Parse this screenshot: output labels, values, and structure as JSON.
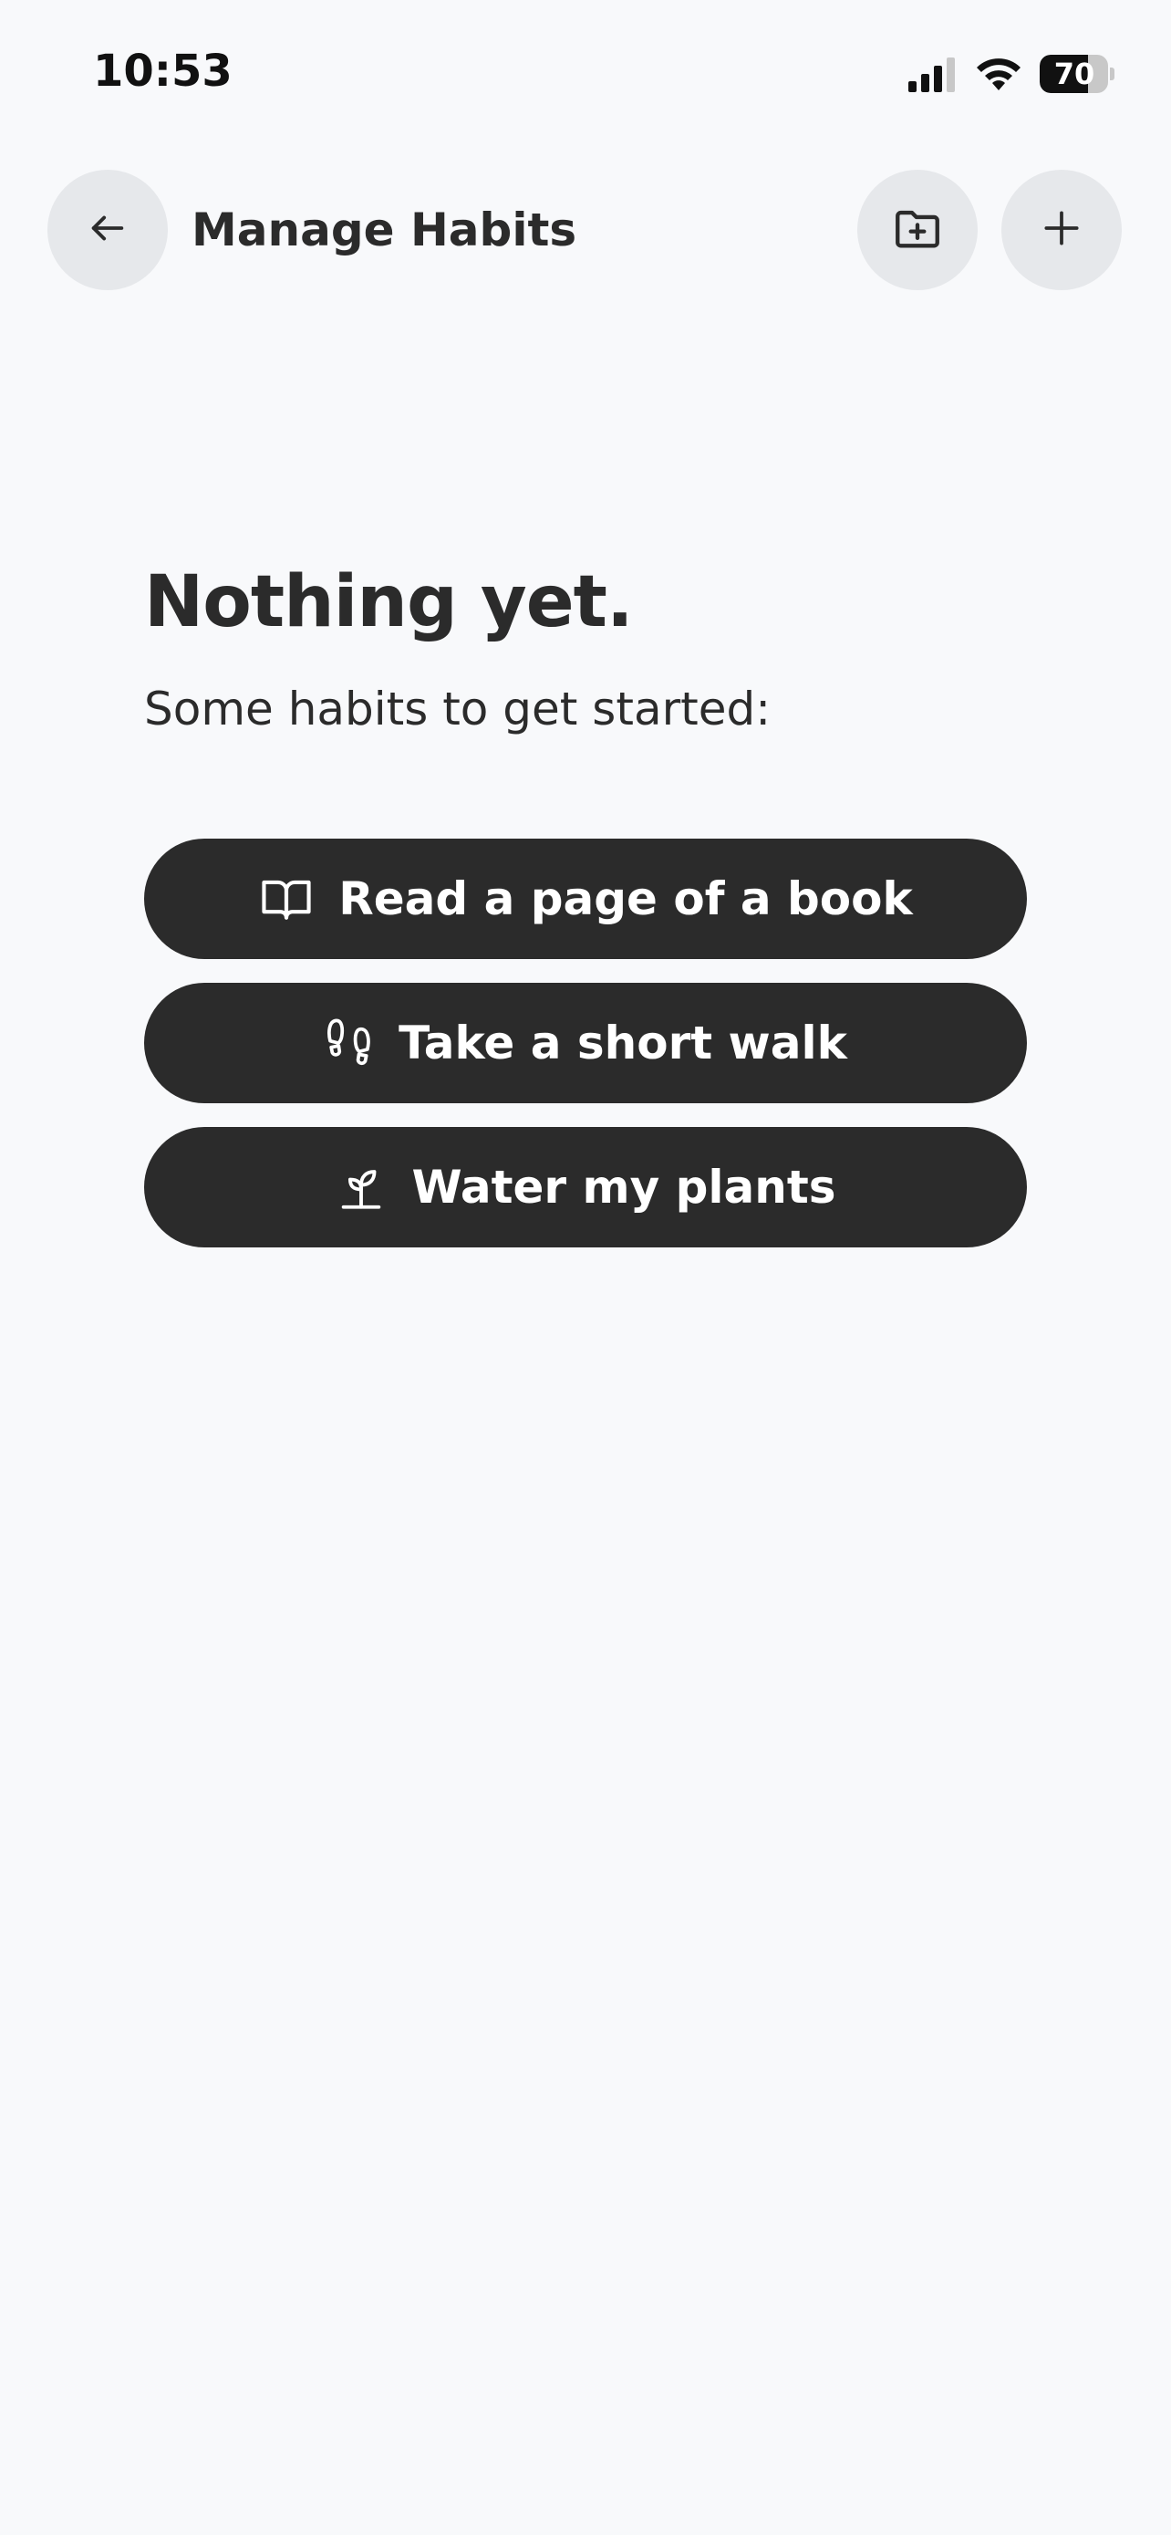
{
  "status_bar": {
    "time": "10:53",
    "battery_percent": "70",
    "battery_level": 0.7,
    "icons": [
      "signal-icon",
      "wifi-icon",
      "battery-icon"
    ]
  },
  "header": {
    "title": "Manage Habits",
    "back_icon": "arrow-left-icon",
    "folder_icon": "folder-plus-icon",
    "add_icon": "plus-icon"
  },
  "empty_state": {
    "title": "Nothing yet.",
    "subtitle": "Some habits to get started:"
  },
  "suggestions": [
    {
      "label": "Read a page of a book",
      "icon": "book-icon"
    },
    {
      "label": "Take a short walk",
      "icon": "footprints-icon"
    },
    {
      "label": "Water my plants",
      "icon": "sprout-icon"
    }
  ],
  "colors": {
    "background": "#f8f9fb",
    "button_dark": "#2b2b2b",
    "circle_button": "#e6e8eb",
    "text": "#2b2b2b"
  }
}
